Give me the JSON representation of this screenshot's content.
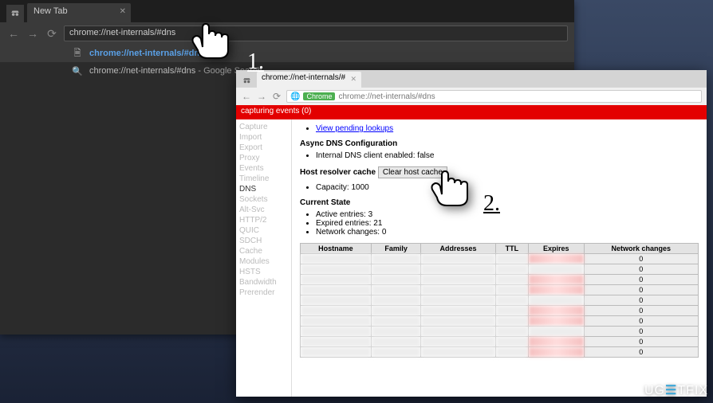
{
  "window1": {
    "tab_title": "New Tab",
    "address": "chrome://net-internals/#dns",
    "suggestions": [
      {
        "text_bold": "chrome://net-internals/#dns",
        "suffix": ""
      },
      {
        "text_bold": "chrome://net-internals/#dns",
        "suffix": " - Google Search"
      }
    ]
  },
  "window2": {
    "tab_title": "chrome://net-internals/#",
    "addr_badge": "Chrome",
    "address": "chrome://net-internals/#dns",
    "capture_bar": "capturing events (0)",
    "sidebar": {
      "items": [
        "Capture",
        "Import",
        "Export",
        "Proxy",
        "Events",
        "Timeline",
        "DNS",
        "Sockets",
        "Alt-Svc",
        "HTTP/2",
        "QUIC",
        "SDCH",
        "Cache",
        "Modules",
        "HSTS",
        "Bandwidth",
        "Prerender"
      ],
      "active": "DNS"
    },
    "content": {
      "link_pending": "View pending lookups",
      "async_title": "Async DNS Configuration",
      "async_bullet": "Internal DNS client enabled: false",
      "hrc_label": "Host resolver cache",
      "hrc_button": "Clear host cache",
      "capacity_bullet": "Capacity: 1000",
      "current_state": "Current State",
      "state_bullets": [
        "Active entries: 3",
        "Expired entries: 21",
        "Network changes: 0"
      ],
      "table": {
        "headers": [
          "Hostname",
          "Family",
          "Addresses",
          "TTL",
          "Expires",
          "Network changes"
        ],
        "network_changes_col_default": "0",
        "rows": 10
      }
    }
  },
  "steps": {
    "one": "1.",
    "two": "2."
  },
  "logo": {
    "part1": "UG",
    "glyph": "☰",
    "part2": "TFIX"
  }
}
